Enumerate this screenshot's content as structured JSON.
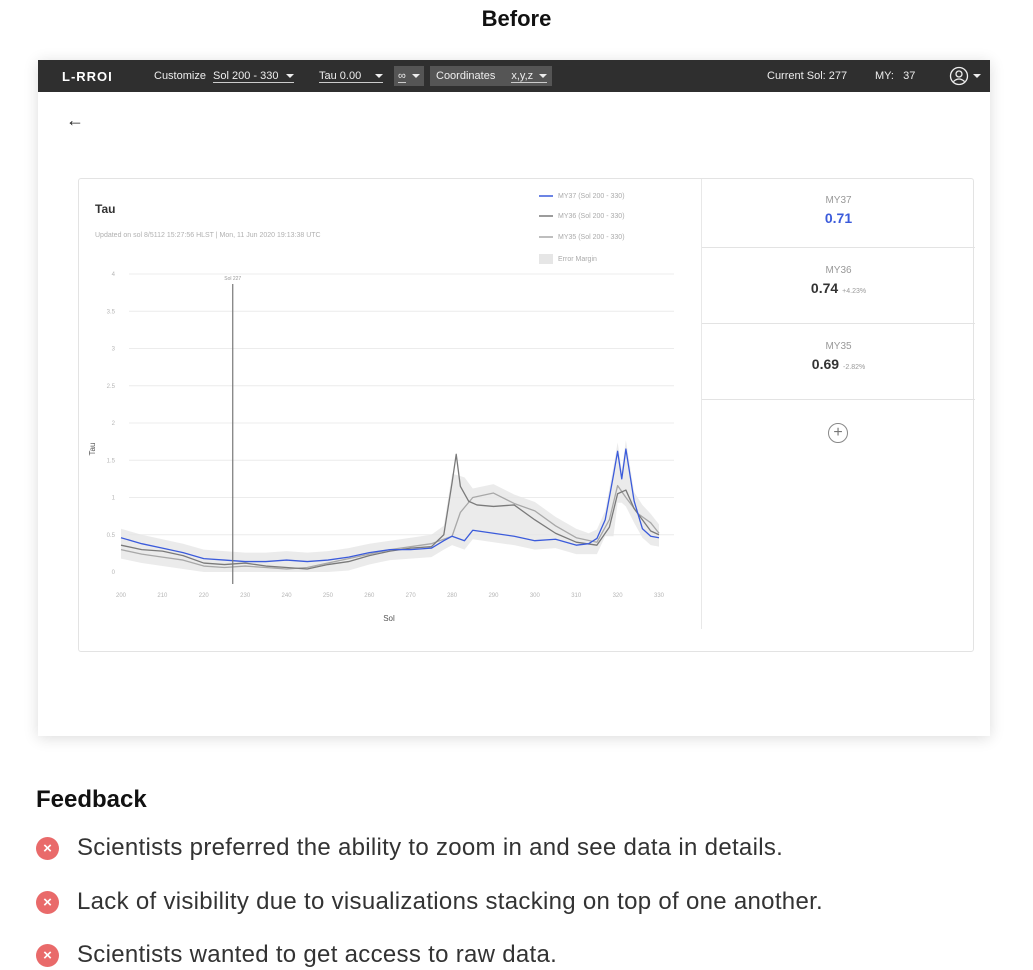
{
  "page_title": "Before",
  "topbar": {
    "logo": "L-RROI",
    "customize": "Customize",
    "sol_range": "Sol  200 - 330",
    "tau": "Tau  0.00",
    "infinity": "∞",
    "coordinates_label": "Coordinates",
    "coordinates_value": "x,y,z",
    "current_sol_label": "Current Sol:",
    "current_sol_value": "277",
    "my_label": "MY:",
    "my_value": "37",
    "user_icon": "user-circle-icon"
  },
  "card": {
    "title": "Tau",
    "updated": "Updated on sol 8/5112 15:27:56 HLST | Mon, 11 Jun 2020 19:13:38 UTC",
    "cursor_label": "Sol 227"
  },
  "chart_data": {
    "type": "line",
    "xlabel": "Sol",
    "ylabel": "Tau",
    "xlim": [
      200,
      330
    ],
    "ylim": [
      0,
      4
    ],
    "x_ticks": [
      "200",
      "210",
      "220",
      "230",
      "240",
      "250",
      "260",
      "270",
      "280",
      "290",
      "300",
      "310",
      "320",
      "330"
    ],
    "y_ticks": [
      "0",
      "0.5",
      "1",
      "1.5",
      "2",
      "2.5",
      "3",
      "3.5",
      "4"
    ],
    "cursor_x": 227,
    "legend": [
      "MY37 (Sol 200 - 330)",
      "MY36 (Sol 200 - 330)",
      "MY35 (Sol 200 - 330)",
      "Error Margin"
    ],
    "series": [
      {
        "name": "MY37 (Sol 200 - 330)",
        "color": "#3b5bdb",
        "x": [
          200,
          205,
          210,
          215,
          220,
          225,
          230,
          235,
          240,
          245,
          250,
          255,
          260,
          265,
          270,
          275,
          278,
          280,
          283,
          285,
          290,
          295,
          300,
          305,
          310,
          313,
          315,
          317,
          319,
          320,
          321,
          322,
          324,
          326,
          328,
          330
        ],
        "y": [
          0.46,
          0.38,
          0.32,
          0.26,
          0.18,
          0.16,
          0.14,
          0.14,
          0.16,
          0.14,
          0.16,
          0.2,
          0.26,
          0.3,
          0.3,
          0.32,
          0.42,
          0.48,
          0.42,
          0.56,
          0.52,
          0.48,
          0.42,
          0.44,
          0.36,
          0.38,
          0.45,
          0.7,
          1.3,
          1.62,
          1.25,
          1.65,
          0.95,
          0.58,
          0.48,
          0.46
        ]
      },
      {
        "name": "MY36 (Sol 200 - 330)",
        "color": "#7a7a7a",
        "x": [
          200,
          205,
          210,
          215,
          220,
          225,
          230,
          235,
          240,
          245,
          250,
          255,
          260,
          265,
          270,
          275,
          278,
          280,
          281,
          282,
          284,
          286,
          290,
          295,
          300,
          305,
          310,
          315,
          318,
          320,
          322,
          324,
          326,
          328,
          330
        ],
        "y": [
          0.36,
          0.3,
          0.28,
          0.22,
          0.12,
          0.1,
          0.12,
          0.08,
          0.06,
          0.04,
          0.1,
          0.14,
          0.22,
          0.28,
          0.32,
          0.34,
          0.5,
          1.2,
          1.58,
          1.15,
          0.95,
          0.9,
          0.88,
          0.9,
          0.7,
          0.52,
          0.4,
          0.36,
          0.6,
          1.05,
          1.1,
          0.85,
          0.7,
          0.55,
          0.5
        ]
      },
      {
        "name": "MY35 (Sol 200 - 330)",
        "color": "#a8a8a8",
        "x": [
          200,
          205,
          210,
          215,
          220,
          225,
          230,
          235,
          240,
          245,
          250,
          255,
          260,
          265,
          270,
          275,
          280,
          282,
          285,
          290,
          295,
          300,
          305,
          310,
          315,
          318,
          320,
          322,
          325,
          328,
          330
        ],
        "y": [
          0.3,
          0.24,
          0.2,
          0.16,
          0.08,
          0.06,
          0.08,
          0.06,
          0.04,
          0.06,
          0.12,
          0.18,
          0.24,
          0.3,
          0.34,
          0.38,
          0.48,
          0.8,
          1.0,
          1.06,
          0.92,
          0.82,
          0.62,
          0.46,
          0.4,
          0.7,
          1.16,
          1.0,
          0.78,
          0.66,
          0.52
        ]
      }
    ]
  },
  "metrics": [
    {
      "label": "MY37",
      "value": "0.71",
      "delta": ""
    },
    {
      "label": "MY36",
      "value": "0.74",
      "delta": "+4.23%"
    },
    {
      "label": "MY35",
      "value": "0.69",
      "delta": "-2.82%"
    }
  ],
  "add_icon": "plus-circle-icon",
  "feedback": {
    "title": "Feedback",
    "items": [
      "Scientists preferred the ability to zoom in and see data in details.",
      "Lack of visibility due to visualizations stacking on top of one another.",
      "Scientists wanted to get access to raw data."
    ]
  }
}
